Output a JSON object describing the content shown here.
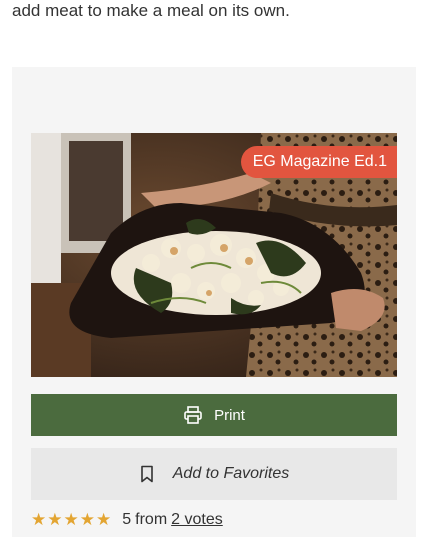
{
  "intro_text": "add meat to make a meal on its own.",
  "image": {
    "badge": "EG Magazine Ed.1"
  },
  "buttons": {
    "print_label": "Print",
    "favorites_label": "Add to Favorites"
  },
  "rating": {
    "stars": 5,
    "score": "5",
    "from_label": "from",
    "votes_link": "2 votes"
  },
  "colors": {
    "print_button": "#4b6b3e",
    "badge": "#e2553f",
    "stars": "#e3a532",
    "card_bg": "#f5f5f5"
  }
}
